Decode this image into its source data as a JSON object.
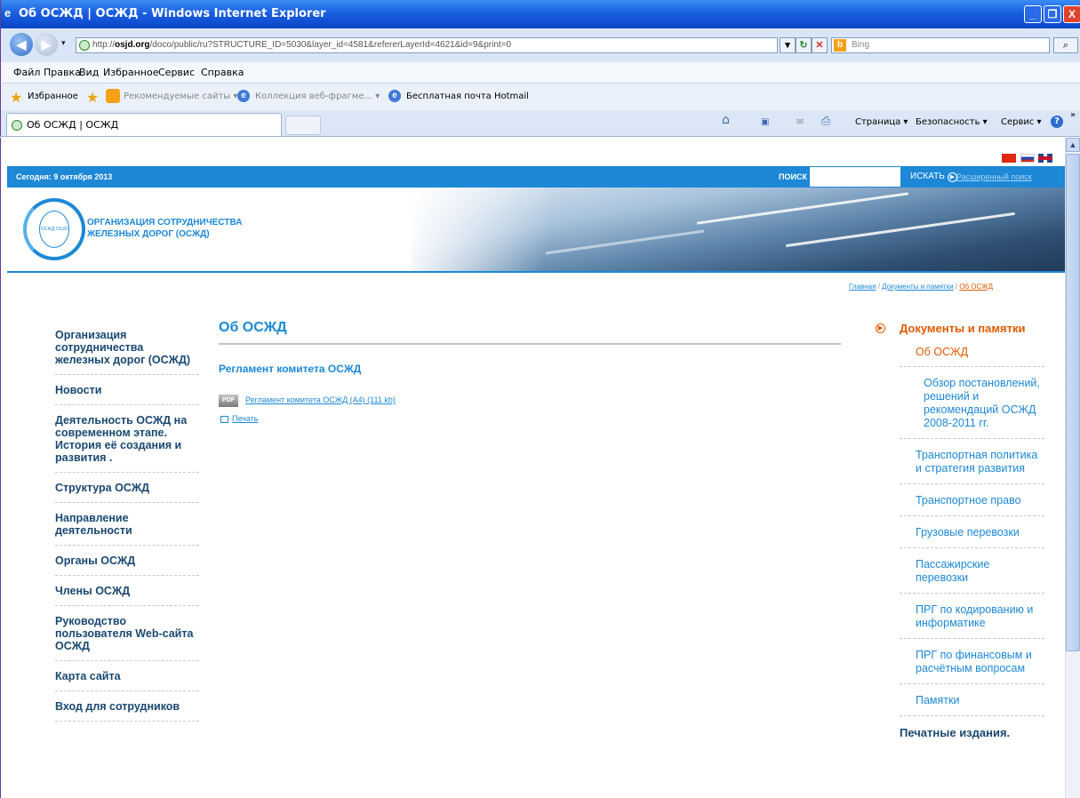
{
  "window": {
    "title": "Об ОСЖД | ОСЖД - Windows Internet Explorer",
    "min_glyph": "_",
    "max_glyph": "❐",
    "close_glyph": "X"
  },
  "address": {
    "url_prefix": "http://",
    "url_host": "osjd.org",
    "url_rest": "/doco/public/ru?STRUCTURE_ID=5030&layer_id=4581&refererLayerId=4621&id=9&print=0",
    "search_placeholder": "Bing",
    "bing_letter": "b"
  },
  "menu": [
    "Файл",
    "Правка",
    "Вид",
    "Избранное",
    "Сервис",
    "Справка"
  ],
  "favorites": {
    "label": "Избранное",
    "links": [
      "Рекомендуемые сайты ▾",
      "Коллекция веб-фрагме... ▾",
      "Бесплатная почта Hotmail"
    ]
  },
  "tab": {
    "title": "Об ОСЖД | ОСЖД"
  },
  "commands": [
    "Страница ▾",
    "Безопасность ▾",
    "Сервис ▾"
  ],
  "site": {
    "date": "Сегодня: 9 октября 2013",
    "search_label": "ПОИСК",
    "search_button": "ИСКАТЬ",
    "search_button_arrow": "▶",
    "advanced_search": "Расширенный поиск",
    "logo_line1": "ОРГАНИЗАЦИЯ СОТРУДНИЧЕСТВА",
    "logo_line2": "ЖЕЛЕЗНЫХ ДОРОГ (ОСЖД)",
    "logo_badge": "ОСЖД OSJD"
  },
  "breadcrumb": {
    "items": [
      "Главная",
      "Документы и памятки"
    ],
    "current": "Об ОСЖД",
    "separator": "/"
  },
  "left_nav": [
    "Организация сотрудничества железных дорог (ОСЖД)",
    "Новости",
    "Деятельность ОСЖД на современном этапе. История её создания и развития .",
    "Структура ОСЖД",
    "Направление деятельности",
    "Органы ОСЖД",
    "Члены ОСЖД",
    "Руководство пользователя Web-сайта ОСЖД",
    "Карта сайта",
    "Вход для сотрудников"
  ],
  "main": {
    "title": "Об ОСЖД",
    "subtitle": "Регламент комитета ОСЖД",
    "doc_badge": "PDF",
    "doc_link": "Регламент комитета ОСЖД (А4) (111 kb)",
    "print_link": "Печать"
  },
  "right_nav": {
    "heading": "Документы и памятки",
    "heading_arrow": "▶",
    "current": "Об ОСЖД",
    "nested": "Обзор постановлений, решений и рекомендаций ОСЖД 2008-2011 гг.",
    "items": [
      "Транспортная политика и стратегия развития",
      "Транспортное право",
      "Грузовые перевозки",
      "Пассажирские перевозки",
      "ПРГ по кодированию и информатике",
      "ПРГ по финансовым и расчётным вопросам",
      "Памятки"
    ],
    "print_publications": "Печатные издания."
  },
  "icons": {
    "app": "e",
    "back": "◀",
    "forward": "▶",
    "recent_dropdown": "▾",
    "url_dropdown": "▾",
    "refresh": "↻",
    "stop": "✕",
    "search_go": "⌕",
    "star": "★",
    "ie": "e",
    "home": "⌂",
    "feeds": "▣",
    "mail": "✉",
    "printer": "⎙",
    "help": "?",
    "more": "»",
    "scroll_up": "▲"
  }
}
